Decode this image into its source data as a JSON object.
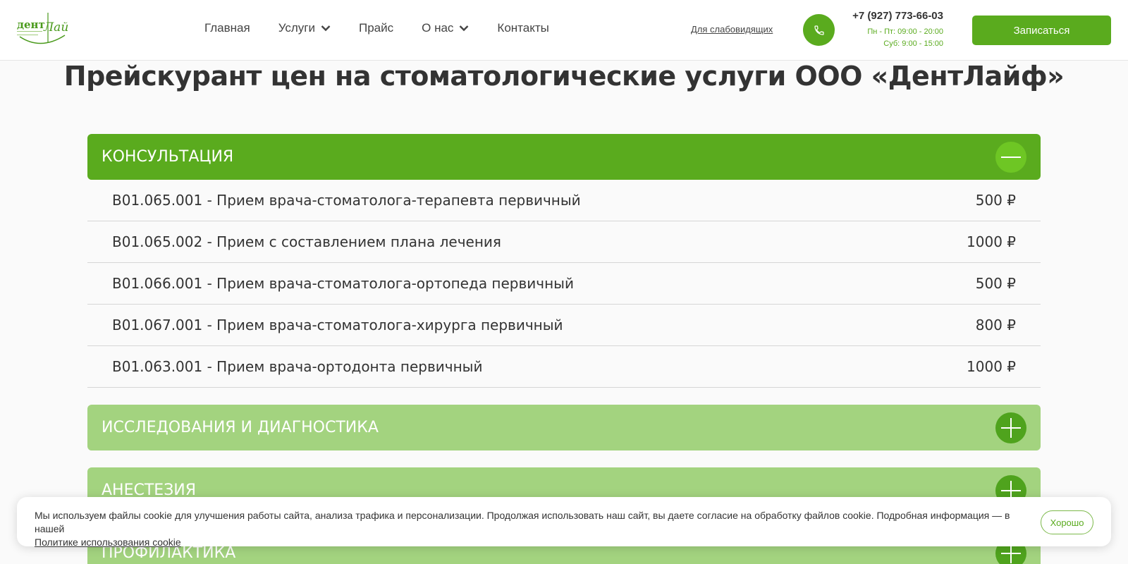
{
  "header": {
    "logo_text": "дент Лайф",
    "nav": [
      {
        "label": "Главная",
        "has_dropdown": false
      },
      {
        "label": "Услуги",
        "has_dropdown": true
      },
      {
        "label": "Прайс",
        "has_dropdown": false
      },
      {
        "label": "О нас",
        "has_dropdown": true
      },
      {
        "label": "Контакты",
        "has_dropdown": false
      }
    ],
    "accessibility_link": "Для слабовидящих",
    "phone": "+7 (927) 773-66-03",
    "hours_weekday": "Пн - Пт: 09:00 - 20:00",
    "hours_saturday": "Суб: 9:00 - 15:00",
    "signup_label": "Записаться"
  },
  "page_title": "Прейскурант цен на стоматологические услуги ООО «ДентЛайф»",
  "sections": [
    {
      "label": "КОНСУЛЬТАЦИЯ",
      "expanded": true,
      "rows": [
        {
          "service": "B01.065.001 - Прием врача-стоматолога-терапевта первичный",
          "price": "500 ₽"
        },
        {
          "service": "B01.065.002 - Прием с составлением плана лечения",
          "price": "1000 ₽"
        },
        {
          "service": "B01.066.001 - Прием врача-стоматолога-ортопеда первичный",
          "price": "500 ₽"
        },
        {
          "service": "B01.067.001 - Прием врача-стоматолога-хирурга первичный",
          "price": "800 ₽"
        },
        {
          "service": "B01.063.001 - Прием врача-ортодонта первичный",
          "price": "1000 ₽"
        }
      ]
    },
    {
      "label": "ИССЛЕДОВАНИЯ И ДИАГНОСТИКА",
      "expanded": false
    },
    {
      "label": "АНЕСТЕЗИЯ",
      "expanded": false
    },
    {
      "label": "ПРОФИЛАКТИКА",
      "expanded": false
    }
  ],
  "cookie": {
    "text": "Мы используем файлы cookie для улучшения работы сайта, анализа трафика и персонализации. Продолжая использовать наш сайт, вы даете согласие на обработку файлов cookie. Подробная информация — в нашей",
    "link": "Политике использования cookie",
    "ok_label": "Хорошо"
  },
  "colors": {
    "brand_green": "#5aab1e",
    "light_green": "#a3d37f"
  }
}
